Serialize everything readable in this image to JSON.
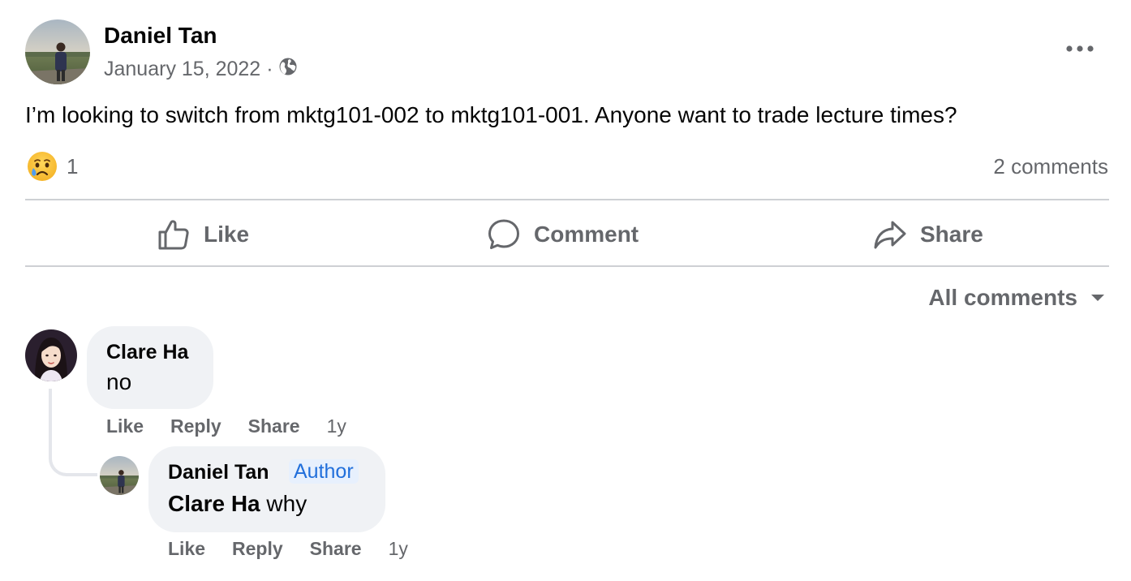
{
  "post": {
    "author": "Daniel Tan",
    "date": "January 15, 2022",
    "separator": "·",
    "privacy_icon": "globe-icon",
    "more_icon": "more-horizontal-icon",
    "text": "I’m looking to switch from mktg101-002 to mktg101-001. Anyone want to trade lecture times?",
    "reaction_icon": "sad-reaction-icon",
    "reaction_count": "1",
    "comment_count": "2 comments"
  },
  "actions": {
    "like": "Like",
    "comment": "Comment",
    "share": "Share"
  },
  "comments_sort": {
    "label": "All comments",
    "icon": "caret-down-icon"
  },
  "comments": [
    {
      "author": "Clare Ha",
      "text": "no",
      "like": "Like",
      "reply": "Reply",
      "share": "Share",
      "time": "1y",
      "replies": [
        {
          "author": "Daniel Tan",
          "badge": "Author",
          "mention": "Clare Ha",
          "text": "why",
          "like": "Like",
          "reply": "Reply",
          "share": "Share",
          "time": "1y"
        }
      ]
    }
  ],
  "colors": {
    "secondary_text": "#65676b",
    "bubble": "#f0f2f5",
    "divider": "#ced0d4",
    "author_badge": "#216fdb"
  }
}
